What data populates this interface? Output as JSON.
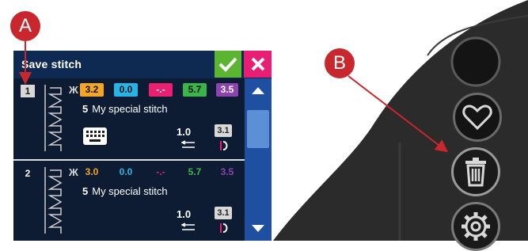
{
  "callouts": {
    "a": "A",
    "b": "B"
  },
  "dialog": {
    "title": "Save stitch",
    "ok_icon": "checkmark-icon",
    "close_icon": "close-icon",
    "colors": {
      "title_bar": "#0f2a52",
      "ok": "#5cb531",
      "close": "#e81e74",
      "scroll": "#1f4fa0"
    }
  },
  "stitches": [
    {
      "number": "1",
      "width": "3.2",
      "position": "0.0",
      "balance": "-.-",
      "length": "5.7",
      "density": "3.5",
      "name_number": "5",
      "name": "My special stitch",
      "stitch_length": "1.0",
      "tension": "3.1"
    },
    {
      "number": "2",
      "width": "3.0",
      "position": "0.0",
      "balance": "-.-",
      "length": "5.7",
      "density": "3.5",
      "name_number": "5",
      "name": "My special stitch",
      "stitch_length": "1.0",
      "tension": "3.1"
    }
  ],
  "side_buttons": [
    "favorite-icon",
    "delete-icon",
    "settings-icon"
  ]
}
